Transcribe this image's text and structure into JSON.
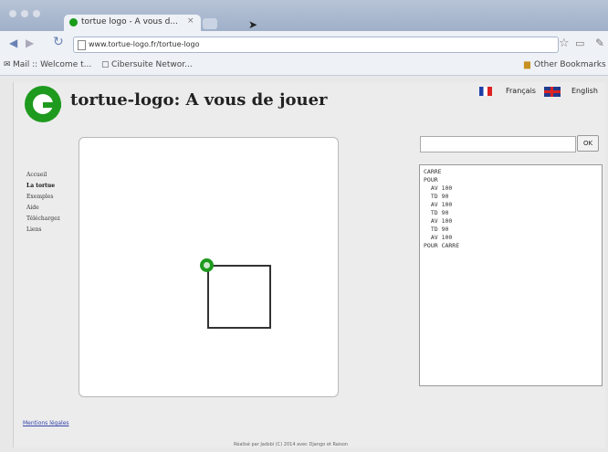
{
  "browser": {
    "tab_title": "tortue logo - A vous d...",
    "tab_close": "×",
    "url": "www.tortue-logo.fr/tortue-logo",
    "bookmarks": [
      "Mail :: Welcome t...",
      "Cibersuite Networ..."
    ],
    "other_bookmarks": "Other Bookmarks"
  },
  "header": {
    "title": "tortue-logo: A vous de jouer",
    "lang_fr": "Français",
    "lang_en": "English"
  },
  "nav": {
    "items": [
      "Accueil",
      "La tortue",
      "Exemples",
      "Aide",
      "Téléchargez",
      "Liens"
    ]
  },
  "console": {
    "ok_label": "OK",
    "code": "CARRE\nPOUR\n  AV 100\n  TD 90\n  AV 100\n  TD 90\n  AV 100\n  TD 90\n  AV 100\nPOUR CARRE"
  },
  "footer": {
    "link": "Mentions légales",
    "credit": "Réalisé par Jadsbi (C) 2014 avec Django et Raison"
  },
  "colors": {
    "accent": "#1e9a1e",
    "link": "#3344aa"
  }
}
